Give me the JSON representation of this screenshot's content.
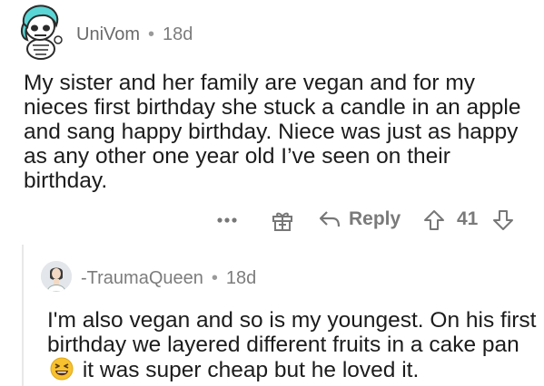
{
  "comment": {
    "username": "UniVom",
    "separator": "•",
    "age": "18d",
    "text": "My sister and her family are vegan and for my nieces first birthday she stuck a candle in an apple and sang happy birthday. Niece was just as happy as any other one year old I’ve seen on their birthday."
  },
  "actions": {
    "more_label": "•••",
    "reply_label": "Reply",
    "vote_count": "41",
    "icons": [
      "more-icon",
      "gift-icon",
      "reply-arrow-icon",
      "upvote-icon",
      "downvote-icon"
    ]
  },
  "reply": {
    "username": "-TraumaQueen",
    "separator": "•",
    "age": "18d",
    "text_before_emoji": "I'm also vegan and so is my youngest. On his first birthday we layered different fruits in a cake pan",
    "emoji": "grinning-squinting-face-emoji",
    "text_after_emoji": "it was super cheap but he loved it."
  },
  "colors": {
    "meta_gray": "#7c7c7c",
    "text": "#1c1c1c",
    "emoji_yellow": "#f7c12f"
  }
}
